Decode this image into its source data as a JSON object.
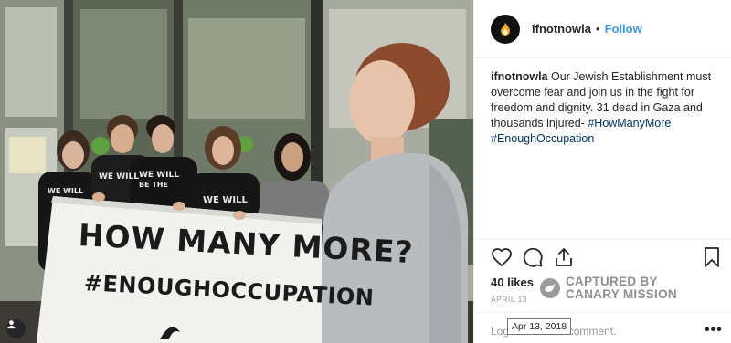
{
  "post": {
    "username": "ifnotnowla",
    "follow_label": "Follow",
    "separator": "•",
    "caption_user": "ifnotnowla",
    "caption_text": "Our Jewish Establishment must overcome fear and join us in the fight for freedom and dignity. 31 dead in Gaza and thousands injured-",
    "hashtags": [
      "#HowManyMore",
      "#EnoughOccupation"
    ],
    "likes": "40 likes",
    "date": "APRIL 13",
    "comment_placeholder": "Log in to like or comment.",
    "more_label": "•••",
    "tooltip": "Apr 13, 2018"
  },
  "photo": {
    "banner_line1": "HOW MANY MORE?",
    "banner_line2": "#ENOUGHOCCUPATION",
    "shirt_text": "WE WILL BE THE GENERATION"
  },
  "watermark": {
    "line1": "CAPTURED BY",
    "line2": "CANARY MISSION"
  },
  "icons": [
    "heart-icon",
    "comment-icon",
    "share-icon",
    "bookmark-icon",
    "user-tag-icon",
    "canary-icon"
  ],
  "colors": {
    "link": "#3897f0",
    "hashtag": "#003569",
    "text": "#262626",
    "muted": "#999999"
  }
}
